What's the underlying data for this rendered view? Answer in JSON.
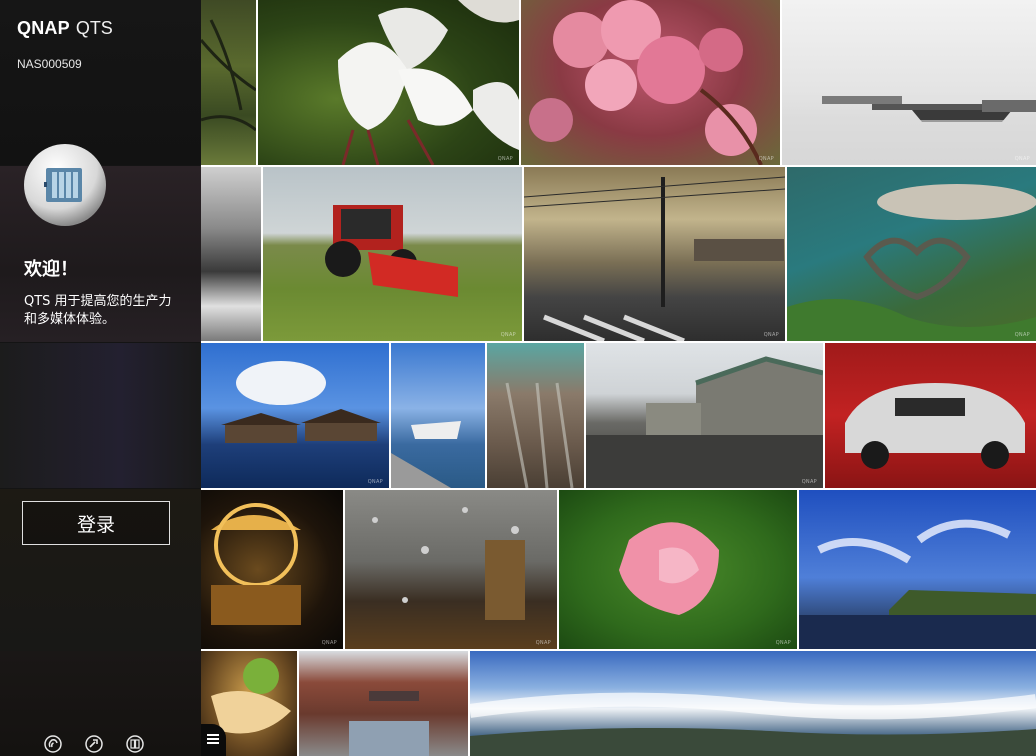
{
  "brand": {
    "name": "QNAP",
    "product": "QTS"
  },
  "hostname": "NAS000509",
  "welcome": "欢迎！",
  "description": "QTS 用于提高您的生产力和多媒体体验。",
  "login": {
    "label": "登录"
  },
  "footer_icons": [
    "mobile-app-icon",
    "helpdesk-icon",
    "manual-icon"
  ],
  "menu_icon": "menu-icon",
  "photo_watermark": "QNAP"
}
